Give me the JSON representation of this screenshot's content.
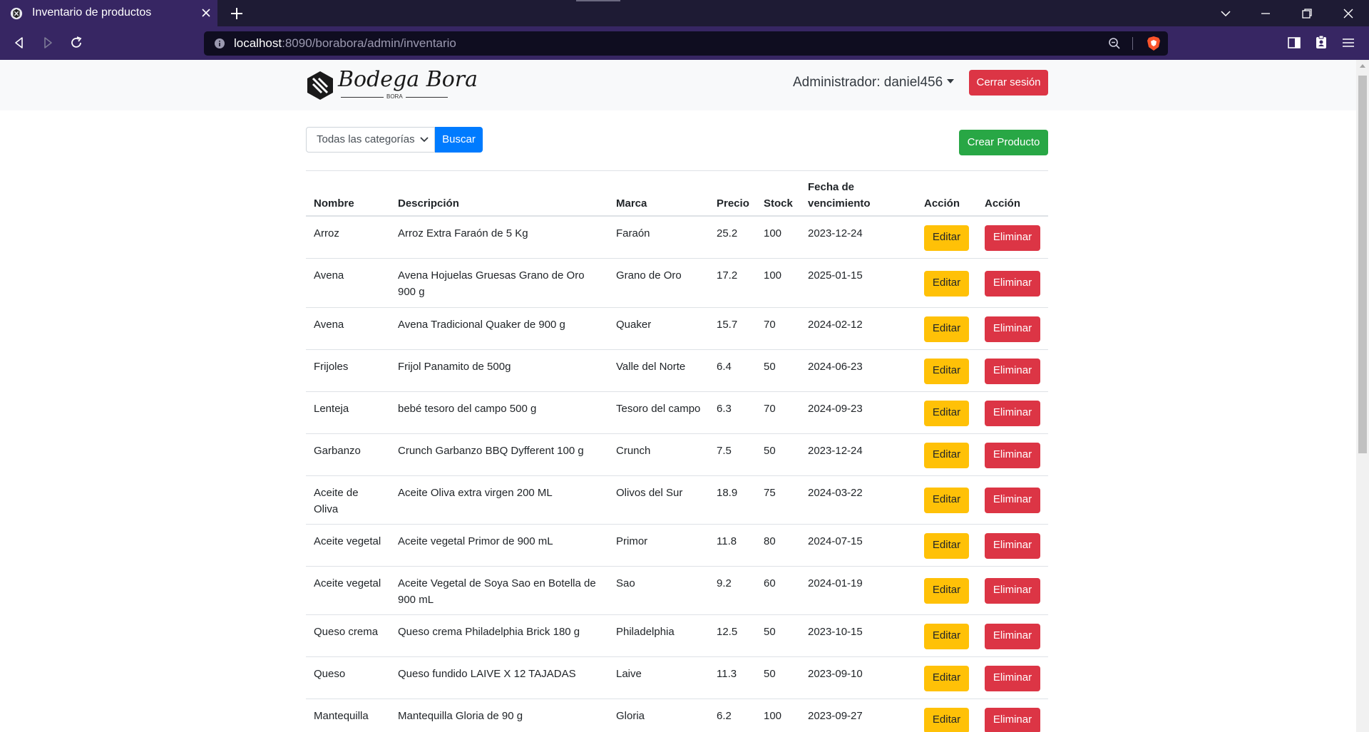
{
  "browser": {
    "tab_title": "Inventario de productos",
    "url_host": "localhost",
    "url_rest": ":8090/borabora/admin/inventario"
  },
  "header": {
    "logo_text": "Bodega Bora",
    "logo_sub": "BORA",
    "admin_label": "Administrador: daniel456",
    "logout_label": "Cerrar sesión"
  },
  "toolbar": {
    "category_selected": "Todas las categorías",
    "search_label": "Buscar",
    "create_label": "Crear Producto"
  },
  "table": {
    "columns": [
      "Nombre",
      "Descripción",
      "Marca",
      "Precio",
      "Stock",
      "Fecha de vencimiento",
      "Acción",
      "Acción"
    ],
    "edit_label": "Editar",
    "delete_label": "Eliminar",
    "rows": [
      {
        "name": "Arroz",
        "desc": "Arroz Extra Faraón de 5 Kg",
        "brand": "Faraón",
        "price": "25.2",
        "stock": "100",
        "date": "2023-12-24"
      },
      {
        "name": "Avena",
        "desc": "Avena Hojuelas Gruesas Grano de Oro 900 g",
        "brand": "Grano de Oro",
        "price": "17.2",
        "stock": "100",
        "date": "2025-01-15"
      },
      {
        "name": "Avena",
        "desc": "Avena Tradicional Quaker de 900 g",
        "brand": "Quaker",
        "price": "15.7",
        "stock": "70",
        "date": "2024-02-12"
      },
      {
        "name": "Frijoles",
        "desc": "Frijol Panamito de 500g",
        "brand": "Valle del Norte",
        "price": "6.4",
        "stock": "50",
        "date": "2024-06-23"
      },
      {
        "name": "Lenteja",
        "desc": "bebé tesoro del campo 500 g",
        "brand": "Tesoro del campo",
        "price": "6.3",
        "stock": "70",
        "date": "2024-09-23"
      },
      {
        "name": "Garbanzo",
        "desc": "Crunch Garbanzo BBQ Dyfferent 100 g",
        "brand": "Crunch",
        "price": "7.5",
        "stock": "50",
        "date": "2023-12-24"
      },
      {
        "name": "Aceite de Oliva",
        "desc": "Aceite Oliva extra virgen 200 ML",
        "brand": "Olivos del Sur",
        "price": "18.9",
        "stock": "75",
        "date": "2024-03-22"
      },
      {
        "name": "Aceite vegetal",
        "desc": "Aceite vegetal Primor de 900 mL",
        "brand": "Primor",
        "price": "11.8",
        "stock": "80",
        "date": "2024-07-15"
      },
      {
        "name": "Aceite vegetal",
        "desc": "Aceite Vegetal de Soya Sao en Botella de 900 mL",
        "brand": "Sao",
        "price": "9.2",
        "stock": "60",
        "date": "2024-01-19"
      },
      {
        "name": "Queso crema",
        "desc": "Queso crema Philadelphia Brick 180 g",
        "brand": "Philadelphia",
        "price": "12.5",
        "stock": "50",
        "date": "2023-10-15"
      },
      {
        "name": "Queso",
        "desc": "Queso fundido LAIVE X 12 TAJADAS",
        "brand": "Laive",
        "price": "11.3",
        "stock": "50",
        "date": "2023-09-10"
      },
      {
        "name": "Mantequilla",
        "desc": "Mantequilla Gloria de 90 g",
        "brand": "Gloria",
        "price": "6.2",
        "stock": "100",
        "date": "2023-09-27"
      }
    ]
  }
}
